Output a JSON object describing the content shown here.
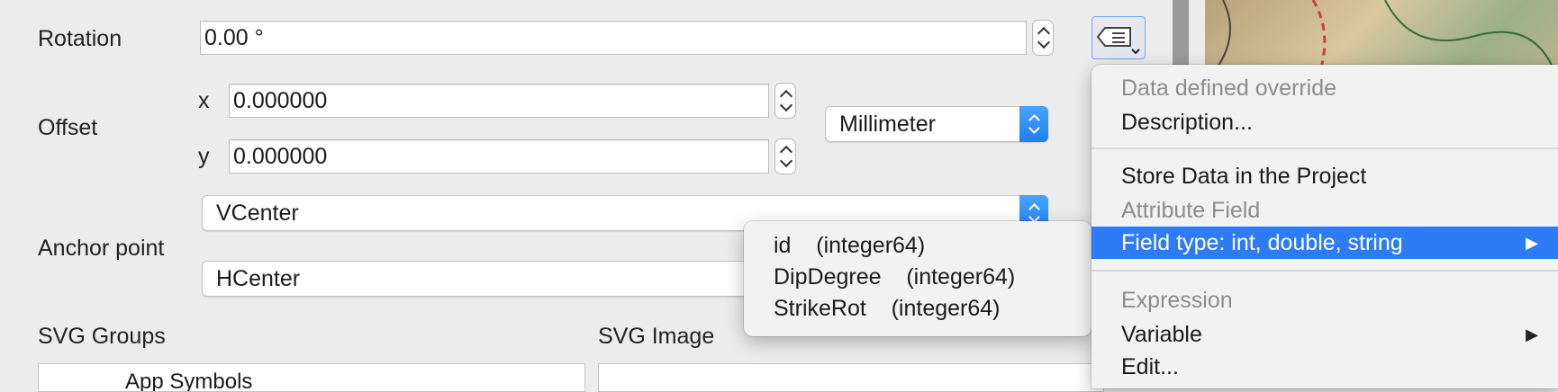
{
  "rotation": {
    "label": "Rotation",
    "value": "0.00 °"
  },
  "offset": {
    "label": "Offset",
    "x_label": "x",
    "x_value": "0.000000",
    "y_label": "y",
    "y_value": "0.000000",
    "unit": "Millimeter"
  },
  "anchor": {
    "label": "Anchor point",
    "vertical": "VCenter",
    "horizontal": "HCenter"
  },
  "svg": {
    "groups_label": "SVG Groups",
    "image_label": "SVG Image",
    "tree_item": "App Symbols"
  },
  "context_menu": {
    "header": "Data defined override",
    "description": "Description...",
    "store": "Store Data in the Project",
    "attribute_header": "Attribute Field",
    "field_type": "Field type: int, double, string",
    "expression_header": "Expression",
    "variable": "Variable",
    "edit": "Edit..."
  },
  "submenu": {
    "items": [
      {
        "name": "id",
        "type": "(integer64)"
      },
      {
        "name": "DipDegree",
        "type": "(integer64)"
      },
      {
        "name": "StrikeRot",
        "type": "(integer64)"
      }
    ]
  },
  "colors": {
    "highlight": "#2d7cf6",
    "accent": "#1e7ff0"
  }
}
